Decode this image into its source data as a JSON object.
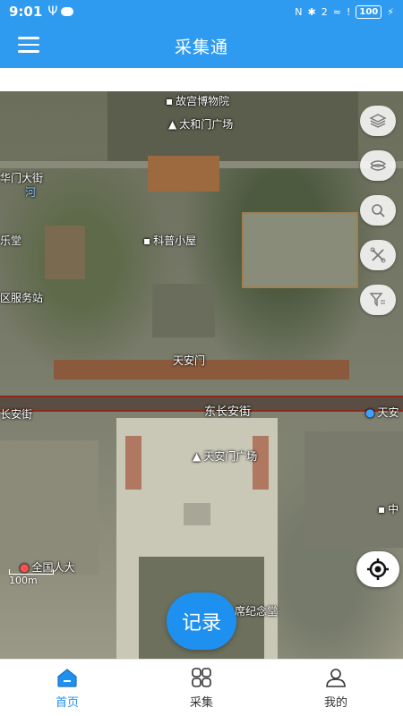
{
  "status": {
    "time": "9:01",
    "battery": "100",
    "network": "2"
  },
  "header": {
    "title": "采集通"
  },
  "map": {
    "labels": {
      "palace_museum": "故宫博物院",
      "taihemen": "太和门广场",
      "huamen": "华门大街",
      "river": "河",
      "lete": "乐堂",
      "kepu": "科普小屋",
      "service": "区服务站",
      "tiananmen": "天安门",
      "changan_west": "长安街",
      "dongchangan": "东长安街",
      "tiananmen_e": "天安",
      "square": "天安门广场",
      "zhong": "中",
      "npc": "全国人大",
      "memorial": "席纪念堂"
    },
    "scale_label": "100m"
  },
  "tools": {
    "layers_icon": "layers-icon",
    "overlay_icon": "overlay-icon",
    "search_icon": "search-icon",
    "tools_icon": "tools-icon",
    "filter_icon": "filter-icon",
    "locate_icon": "locate-icon"
  },
  "record_button": "记录",
  "tabs": [
    {
      "label": "首页",
      "icon": "home-icon",
      "active": true
    },
    {
      "label": "采集",
      "icon": "grid-icon",
      "active": false
    },
    {
      "label": "我的",
      "icon": "user-icon",
      "active": false
    }
  ],
  "colors": {
    "primary": "#2e9bf0",
    "accent": "#1e90f0"
  }
}
